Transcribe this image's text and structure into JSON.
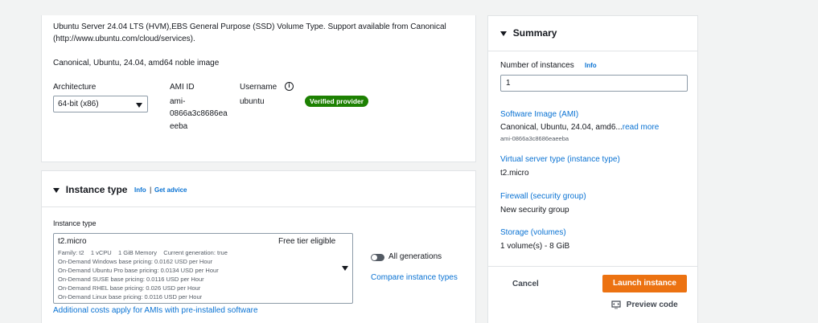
{
  "ami_panel": {
    "description": "Ubuntu Server 24.04 LTS (HVM),EBS General Purpose (SSD) Volume Type. Support available from Canonical",
    "description_url": "(http://www.ubuntu.com/cloud/services).",
    "image_name": "Canonical, Ubuntu, 24.04, amd64 noble image",
    "architecture_label": "Architecture",
    "architecture_value": "64-bit (x86)",
    "ami_id_label": "AMI ID",
    "ami_id_lines": [
      "ami-",
      "0866a3c8686ea",
      "eeba"
    ],
    "username_label": "Username",
    "username_value": "ubuntu",
    "verified_badge": "Verified provider"
  },
  "instance_panel": {
    "title": "Instance type",
    "info": "Info",
    "separator": "|",
    "get_advice": "Get advice",
    "field_label": "Instance type",
    "selected_type": "t2.micro",
    "free_tier": "Free tier eligible",
    "family_line": "Family: t2    1 vCPU    1 GiB Memory    Current generation: true",
    "pricing": [
      "On-Demand Windows base pricing: 0.0162 USD per Hour",
      "On-Demand Ubuntu Pro base pricing: 0.0134 USD per Hour",
      "On-Demand SUSE base pricing: 0.0116 USD per Hour",
      "On-Demand RHEL base pricing: 0.026 USD per Hour",
      "On-Demand Linux base pricing: 0.0116 USD per Hour"
    ],
    "all_generations": "All generations",
    "compare_link": "Compare instance types",
    "additional_costs": "Additional costs apply for AMIs with pre-installed software"
  },
  "summary": {
    "title": "Summary",
    "instances_label": "Number of instances",
    "info": "Info",
    "instances_value": "1",
    "software_image_label": "Software Image (AMI)",
    "software_image_value": "Canonical, Ubuntu, 24.04, amd6...",
    "read_more": "read more",
    "ami_id": "ami-0866a3c8686eaeeba",
    "server_type_label": "Virtual server type (instance type)",
    "server_type_value": "t2.micro",
    "firewall_label": "Firewall (security group)",
    "firewall_value": "New security group",
    "storage_label": "Storage (volumes)",
    "storage_value": "1 volume(s) - 8 GiB",
    "cancel": "Cancel",
    "launch": "Launch instance",
    "preview": "Preview code"
  },
  "colors": {
    "accent": "#0972d3",
    "primary_button": "#ec7211",
    "badge": "#1d8102"
  }
}
